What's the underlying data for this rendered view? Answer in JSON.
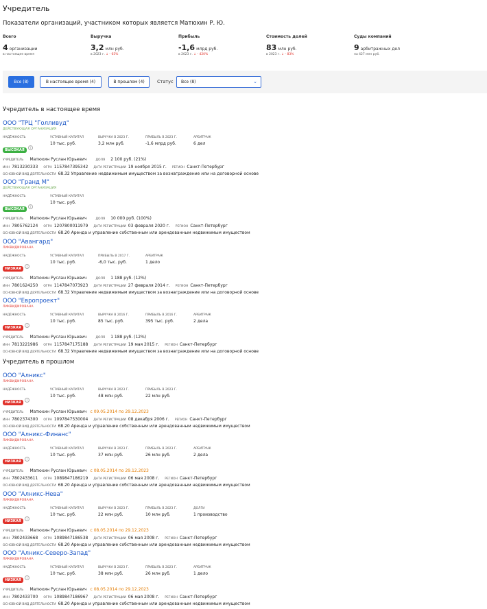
{
  "page": {
    "title": "Учредитель",
    "subtitle": "Показатели организаций, участником которых является Матюхин Р. Ю."
  },
  "stats": [
    {
      "label": "Всего",
      "value": "4",
      "unit": "организации",
      "note": "в настоящее время",
      "note_delta": ""
    },
    {
      "label": "Выручка",
      "value": "3,2",
      "unit": "млн руб.",
      "note": "в 2023 г.",
      "note_delta": "↓ - 65%"
    },
    {
      "label": "Прибыль",
      "value": "-1,6",
      "unit": "млрд руб.",
      "note": "в 2023 г.",
      "note_delta": "↓ - 420%"
    },
    {
      "label": "Стоимость долей",
      "value": "83",
      "unit": "млн руб.",
      "note": "в 2023 г.",
      "note_delta": "↓ - 83%"
    },
    {
      "label": "Суды компаний",
      "value": "9",
      "unit": "арбитражных дел",
      "note": "на 427 млн руб.",
      "note_delta": ""
    }
  ],
  "filters": {
    "all": "Все (8)",
    "current": "В настоящее время (4)",
    "past": "В прошлом (4)",
    "status_label": "Статус",
    "status_value": "Все (8)"
  },
  "sections": {
    "current": "Учредитель в настоящее время",
    "past": "Учредитель в прошлом"
  },
  "labels": {
    "reliability": "надёжность",
    "capital": "уставный капитал",
    "founder": "учредитель",
    "share": "доля",
    "inn": "ИНН",
    "ogrn": "ОГРН",
    "reg_date": "дата регистрации",
    "region": "регион",
    "activity": "основной вид деятельности"
  },
  "companies": [
    {
      "name": "ООО \"ТРЦ \"Голливуд\"",
      "status": "ДЕЙСТВУЮЩАЯ ОРГАНИЗАЦИЯ",
      "badge": "ВЫСОКАЯ",
      "capital": "10 тыс. руб.",
      "m1_label": "выручка в 2023 г.",
      "m1": "3,2 млн руб.",
      "m2_label": "прибыль в 2023 г.",
      "m2": "-1,6 млрд руб.",
      "m3_label": "арбитраж",
      "m3": "6 дел",
      "founder": "Матюхин Руслан Юрьевич",
      "share": "2 100 руб. (21%)",
      "inn": "7813230333",
      "ogrn": "1157847395342",
      "reg_date": "19 ноября 2015 г.",
      "region": "Санкт-Петербург",
      "activity": "68.32 Управление недвижимым имуществом за вознаграждение или на договорной основе"
    },
    {
      "name": "ООО \"Гранд М\"",
      "status": "ДЕЙСТВУЮЩАЯ ОРГАНИЗАЦИЯ",
      "badge": "ВЫСОКАЯ",
      "capital": "10 тыс. руб.",
      "founder": "Матюхин Руслан Юрьевич",
      "share": "10 000 руб. (100%)",
      "inn": "7805762124",
      "ogrn": "1207800011979",
      "reg_date": "03 февраля 2020 г.",
      "region": "Санкт-Петербург",
      "activity": "68.20 Аренда и управление собственным или арендованным недвижимым имуществом"
    },
    {
      "name": "ООО \"Авангард\"",
      "status": "ЛИКВИДИРОВАНА",
      "badge": "НИЗКАЯ",
      "capital": "10 тыс. руб.",
      "m1_label": "прибыль в 2017 г.",
      "m1": "-6,0 тыс. руб.",
      "m2_label": "арбитраж",
      "m2": "1 дело",
      "founder": "Матюхин Руслан Юрьевич",
      "share": "1 188 руб. (12%)",
      "inn": "7801624250",
      "ogrn": "1147847073923",
      "reg_date": "27 февраля 2014 г.",
      "region": "Санкт-Петербург",
      "activity": "68.32 Управление недвижимым имуществом за вознаграждение или на договорной основе"
    },
    {
      "name": "ООО \"Европроект\"",
      "status": "ЛИКВИДИРОВАНА",
      "badge": "НИЗКАЯ",
      "capital": "10 тыс. руб.",
      "m1_label": "выручка в 2016 г.",
      "m1": "85 тыс. руб.",
      "m2_label": "прибыль в 2016 г.",
      "m2": "395 тыс. руб.",
      "m3_label": "арбитраж",
      "m3": "2 дела",
      "founder": "Матюхин Руслан Юрьевич",
      "share": "1 188 руб. (12%)",
      "inn": "7813221986",
      "ogrn": "1157847175188",
      "reg_date": "19 мая 2015 г.",
      "region": "Санкт-Петербург",
      "activity": "68.32 Управление недвижимым имуществом за вознаграждение или на договорной основе"
    },
    {
      "name": "ООО \"Алникс\"",
      "status": "ЛИКВИДИРОВАНА",
      "badge": "НИЗКАЯ",
      "capital": "10 тыс. руб.",
      "m1_label": "выручка в 2023 г.",
      "m1": "48 млн руб.",
      "m2_label": "прибыль в 2023 г.",
      "m2": "22 млн руб.",
      "founder": "Матюхин Руслан Юрьевич",
      "period": "с 09.05.2014 по 29.12.2023",
      "inn": "7802374300",
      "ogrn": "1097847530004",
      "reg_date": "08 декабря 2006 г.",
      "region": "Санкт-Петербург",
      "activity": "68.20 Аренда и управление собственным или арендованным недвижимым имуществом"
    },
    {
      "name": "ООО \"Алникс-Финанс\"",
      "status": "ЛИКВИДИРОВАНА",
      "badge": "НИЗКАЯ",
      "capital": "10 тыс. руб.",
      "m1_label": "выручка в 2023 г.",
      "m1": "37 млн руб.",
      "m2_label": "прибыль в 2023 г.",
      "m2": "26 млн руб.",
      "m3_label": "арбитраж",
      "m3": "2 дела",
      "founder": "Матюхин Руслан Юрьевич",
      "period": "с 08.05.2014 по 29.12.2023",
      "inn": "7802433611",
      "ogrn": "1089847186219",
      "reg_date": "06 мая 2008 г.",
      "region": "Санкт-Петербург",
      "activity": "68.20 Аренда и управление собственным или арендованным недвижимым имуществом"
    },
    {
      "name": "ООО \"Алникс-Нева\"",
      "status": "ЛИКВИДИРОВАНА",
      "badge": "НИЗКАЯ",
      "capital": "10 тыс. руб.",
      "m1_label": "выручка в 2023 г.",
      "m1": "22 млн руб.",
      "m2_label": "прибыль в 2023 г.",
      "m2": "10 млн руб.",
      "m3_label": "долги",
      "m3": "1 производство",
      "founder": "Матюхин Руслан Юрьевич",
      "period": "с 08.05.2014 по 29.12.2023",
      "inn": "7802433668",
      "ogrn": "1089847186538",
      "reg_date": "06 мая 2008 г.",
      "region": "Санкт-Петербург",
      "activity": "68.20 Аренда и управление собственным или арендованным недвижимым имуществом"
    },
    {
      "name": "ООО \"Алникс-Северо-Запад\"",
      "status": "ЛИКВИДИРОВАНА",
      "badge": "НИЗКАЯ",
      "capital": "10 тыс. руб.",
      "m1_label": "выручка в 2023 г.",
      "m1": "38 млн руб.",
      "m2_label": "прибыль в 2023 г.",
      "m2": "26 млн руб.",
      "m3_label": "арбитраж",
      "m3": "1 дело",
      "founder": "Матюхин Руслан Юрьевич",
      "period": "с 08.05.2014 по 29.12.2023",
      "inn": "7802433700",
      "ogrn": "1089847186967",
      "reg_date": "06 мая 2008 г.",
      "region": "Санкт-Петербург",
      "activity": "68.20 Аренда и управление собственным или арендованным недвижимым имуществом"
    }
  ]
}
